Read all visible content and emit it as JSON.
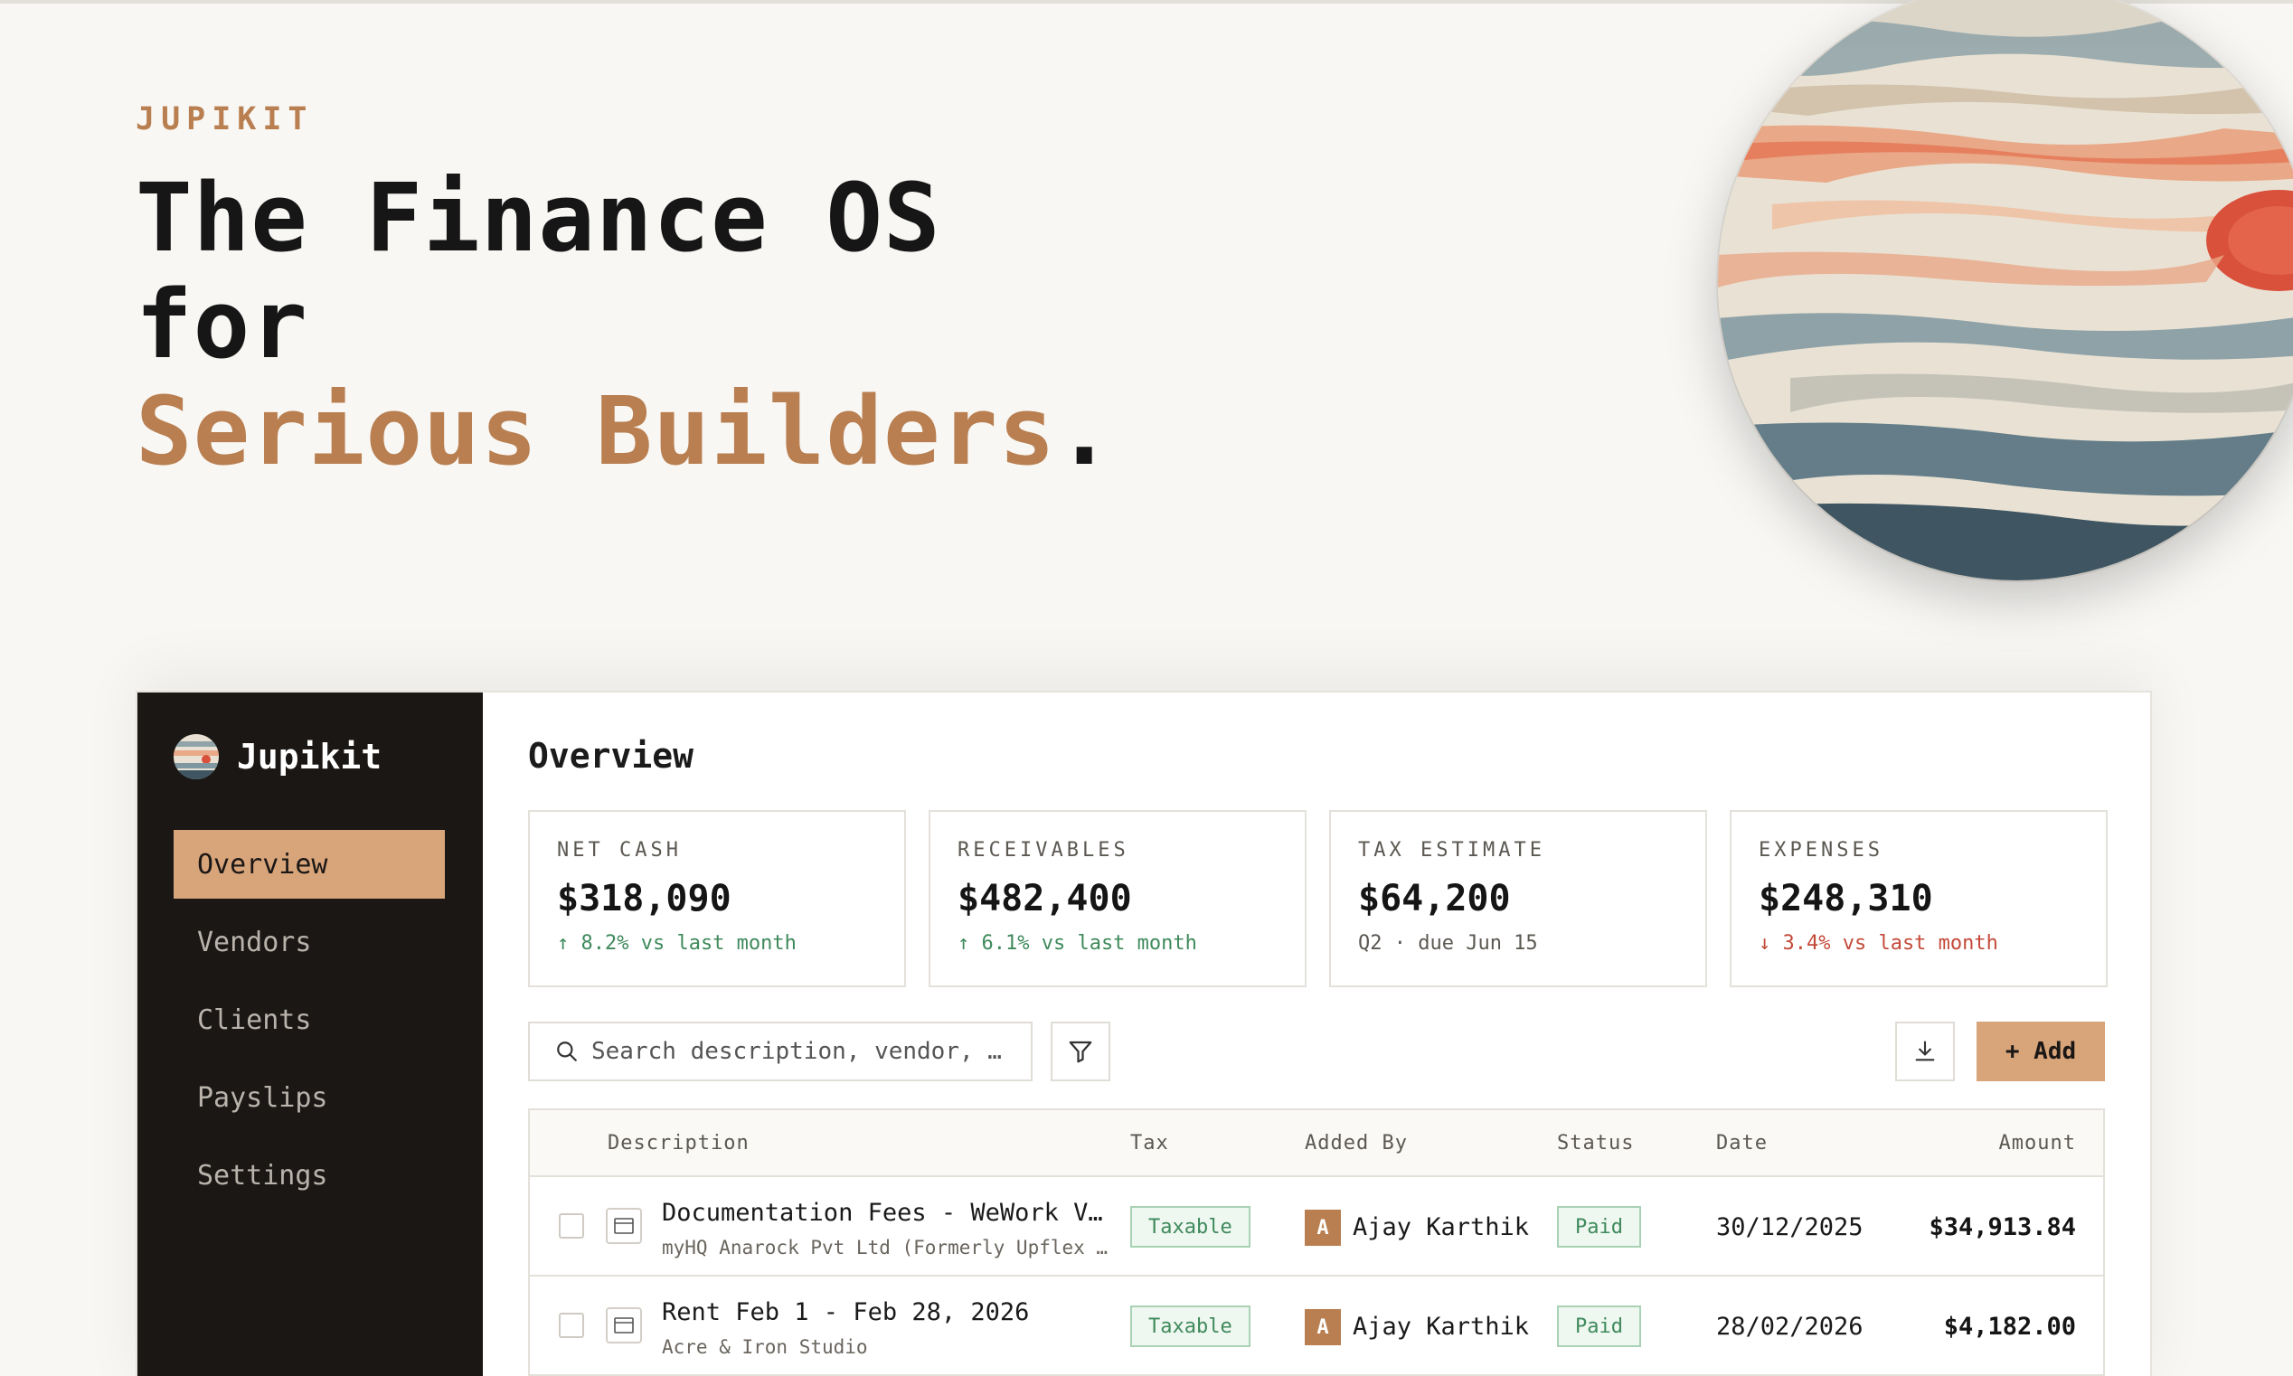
{
  "hero": {
    "kicker": "JUPIKIT",
    "line1": "The Finance OS",
    "line2": "for",
    "line3": "Serious Builders",
    "period": "."
  },
  "sidebar": {
    "brand": "Jupikit",
    "items": [
      {
        "label": "Overview",
        "active": true
      },
      {
        "label": "Vendors",
        "active": false
      },
      {
        "label": "Clients",
        "active": false
      },
      {
        "label": "Payslips",
        "active": false
      },
      {
        "label": "Settings",
        "active": false
      }
    ]
  },
  "main": {
    "title": "Overview",
    "cards": [
      {
        "label": "NET CASH",
        "value": "$318,090",
        "delta": "↑ 8.2% vs last month",
        "trend": "up"
      },
      {
        "label": "RECEIVABLES",
        "value": "$482,400",
        "delta": "↑ 6.1% vs last month",
        "trend": "up"
      },
      {
        "label": "TAX ESTIMATE",
        "value": "$64,200",
        "delta": "Q2 · due Jun 15",
        "trend": "neutral"
      },
      {
        "label": "EXPENSES",
        "value": "$248,310",
        "delta": "↓ 3.4% vs last month",
        "trend": "down"
      }
    ],
    "toolbar": {
      "search_placeholder": "Search description, vendor, …",
      "add_label": "+ Add"
    },
    "table": {
      "columns": [
        "Description",
        "Tax",
        "Added By",
        "Status",
        "Date",
        "Amount"
      ],
      "rows": [
        {
          "description": "Documentation Fees - WeWork Vir…",
          "vendor": "myHQ Anarock Pvt Ltd (Formerly Upflex …",
          "tax": "Taxable",
          "avatar": "A",
          "added_by": "Ajay Karthik",
          "status": "Paid",
          "date": "30/12/2025",
          "amount": "$34,913.84"
        },
        {
          "description": "Rent Feb 1 - Feb 28, 2026",
          "vendor": "Acre & Iron Studio",
          "tax": "Taxable",
          "avatar": "A",
          "added_by": "Ajay Karthik",
          "status": "Paid",
          "date": "28/02/2026",
          "amount": "$4,182.00"
        }
      ]
    }
  },
  "colors": {
    "accent": "#b97f50",
    "accent_light": "#d8a47a",
    "sidebar_bg": "#1a1715",
    "positive": "#3f8a5c",
    "negative": "#c44a3a"
  }
}
